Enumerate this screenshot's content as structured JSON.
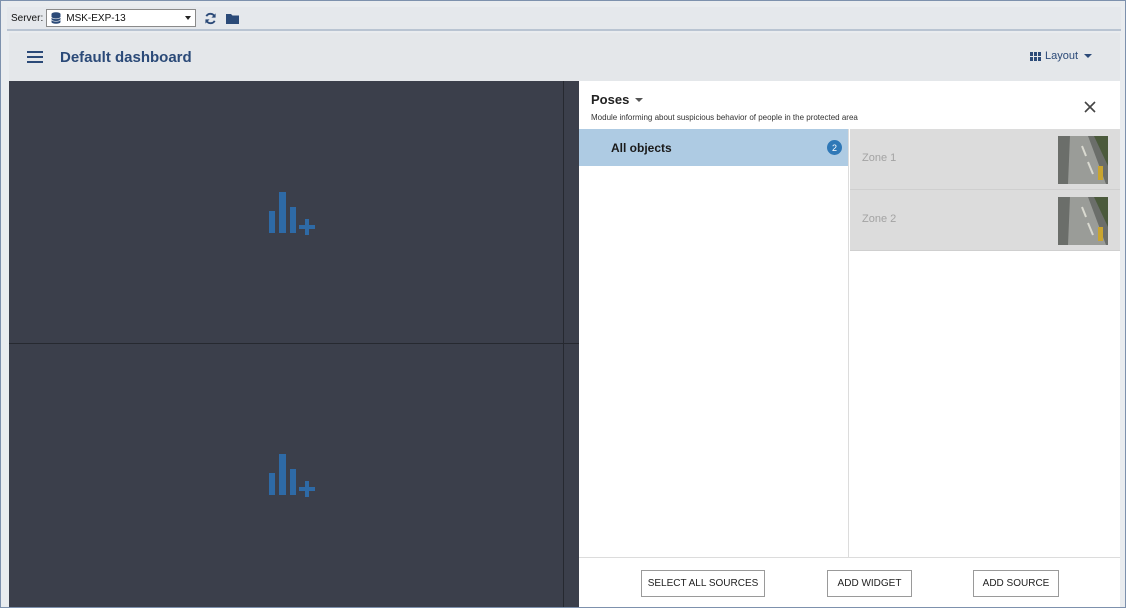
{
  "server_bar": {
    "label": "Server:",
    "selected": "MSK-EXP-13",
    "icons": [
      "database-icon",
      "refresh-icon",
      "folder-icon"
    ]
  },
  "header": {
    "menu_icon": "hamburger-menu-icon",
    "title": "Default dashboard",
    "layout_label": "Layout"
  },
  "dashboard": {
    "cells": [
      {
        "icon": "add-widget-chart-icon"
      },
      {
        "icon": "add-widget-chart-icon"
      }
    ]
  },
  "panel": {
    "title": "Poses",
    "description": "Module informing about suspicious behavior of people in the protected area",
    "objects": [
      {
        "label": "All objects",
        "count": "2"
      }
    ],
    "zones": [
      {
        "label": "Zone 1"
      },
      {
        "label": "Zone 2"
      }
    ],
    "buttons": {
      "select_all": "SELECT ALL SOURCES",
      "add_widget": "ADD WIDGET",
      "add_source": "ADD SOURCE"
    }
  },
  "colors": {
    "accent": "#2b4a78",
    "selected_row": "#aecbe3",
    "badge": "#2f78b7",
    "dashboard_bg": "#3b3f4b",
    "widget_icon": "#2e6aa6"
  }
}
